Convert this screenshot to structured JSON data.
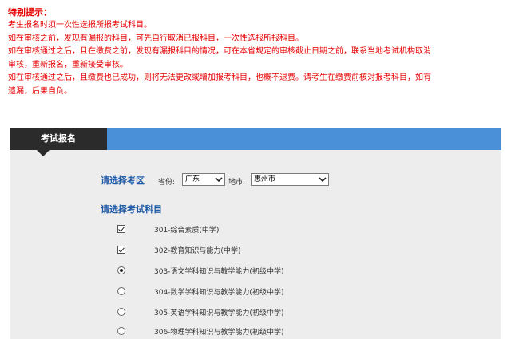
{
  "notice": {
    "title": "特别提示：",
    "lines": [
      "考生报名时须一次性选报所报考试科目。",
      "如在审核之前，发现有漏报的科目，可先自行取消已报科目，一次性选报所报科目。",
      "如在审核通过之后，且在缴费之前，发现有漏报科目的情况，可在本省规定的审核截止日期之前，联系当地考试机构取消",
      "审核，重新报名，重新接受审核。",
      "如在审核通过之后，且缴费也已成功，则将无法更改或增加报考科目，也概不退费。请考生在缴费前核对报考科目，如有",
      "遗漏，后果自负。"
    ]
  },
  "tab": {
    "label": "考试报名"
  },
  "region": {
    "heading": "请选择考区",
    "province_label": "省份:",
    "province_value": "广东",
    "city_label": "地市:",
    "city_value": "惠州市"
  },
  "subjects": {
    "heading": "请选择考试科目",
    "items": [
      {
        "label": "301-综合素质(中学)",
        "control": "checkbox",
        "checked": true
      },
      {
        "label": "302-教育知识与能力(中学)",
        "control": "checkbox",
        "checked": true
      },
      {
        "label": "303-语文学科知识与教学能力(初级中学)",
        "control": "radio",
        "checked": true
      },
      {
        "label": "304-数学学科知识与教学能力(初级中学)",
        "control": "radio",
        "checked": false
      },
      {
        "label": "305-英语学科知识与教学能力(初级中学)",
        "control": "radio",
        "checked": false
      },
      {
        "label": "306-物理学科知识与教学能力(初级中学)",
        "control": "radio",
        "checked": false
      }
    ]
  },
  "colors": {
    "notice_text": "#e60000",
    "tab_bar": "#4a90d9",
    "tab_active": "#2b2b2b",
    "section_heading": "#1f5aa6",
    "panel_bg": "#ededed"
  }
}
